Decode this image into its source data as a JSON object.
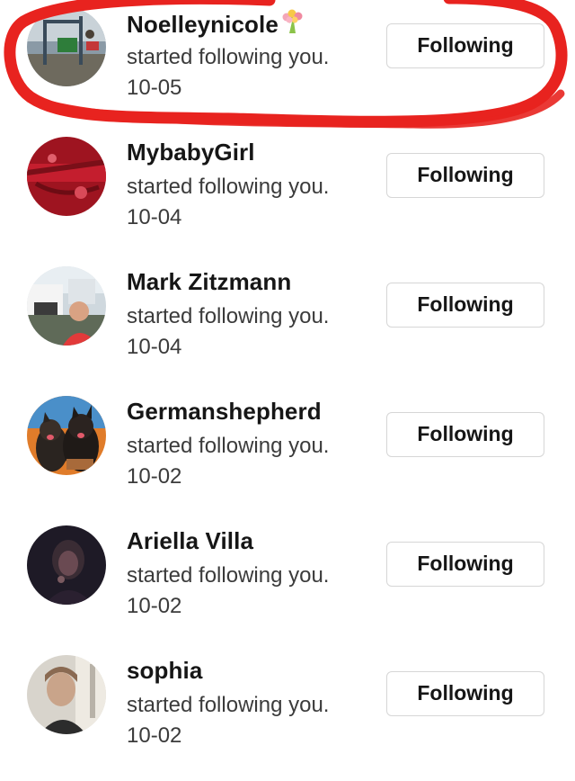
{
  "colors": {
    "annotation_circle": "#e8231f",
    "button_border": "#d6d6d6",
    "name_text": "#161616",
    "secondary_text": "#3b3b3b"
  },
  "notifications": [
    {
      "name": "Noelleynicole",
      "name_emoji": "💐",
      "action": "started following you.",
      "date": "10-05",
      "button_label": "Following",
      "avatar_icon": "playground-photo",
      "highlighted": true
    },
    {
      "name": "MybabyGirl",
      "action": "started following you.",
      "date": "10-04",
      "button_label": "Following",
      "avatar_icon": "red-fabric-photo"
    },
    {
      "name": "Mark Zitzmann",
      "action": "started following you.",
      "date": "10-04",
      "button_label": "Following",
      "avatar_icon": "man-outdoors-photo"
    },
    {
      "name": "Germanshepherd",
      "action": "started following you.",
      "date": "10-02",
      "button_label": "Following",
      "avatar_icon": "two-dogs-photo"
    },
    {
      "name": "Ariella Villa",
      "action": "started following you.",
      "date": "10-02",
      "button_label": "Following",
      "avatar_icon": "dark-portrait-photo"
    },
    {
      "name": "sophia",
      "action": "started following you.",
      "date": "10-02",
      "button_label": "Following",
      "avatar_icon": "selfie-photo"
    }
  ]
}
